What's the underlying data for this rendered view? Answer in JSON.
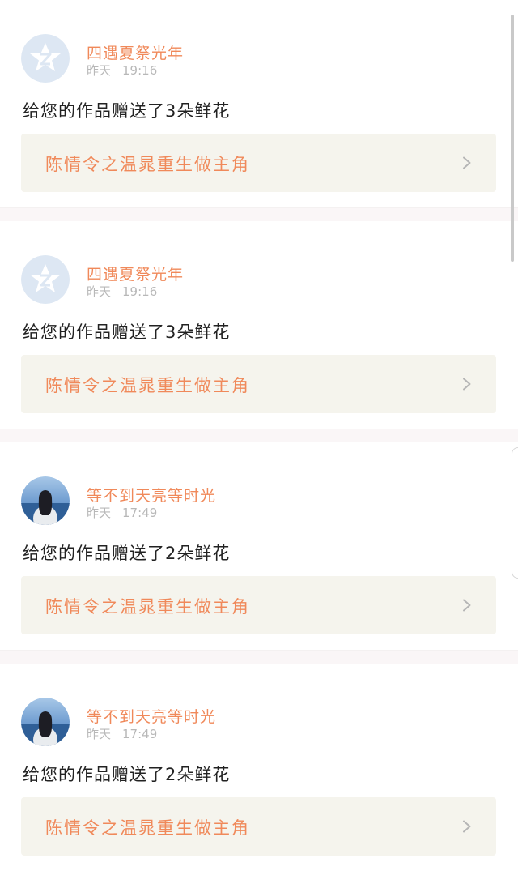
{
  "feed": {
    "items": [
      {
        "name": "四遇夏祭光年",
        "day": "昨天",
        "time": "19:16",
        "message": "给您的作品赠送了3朵鲜花",
        "work_title": "陈情令之温晁重生做主角",
        "avatar": "default-avatar"
      },
      {
        "name": "四遇夏祭光年",
        "day": "昨天",
        "time": "19:16",
        "message": "给您的作品赠送了3朵鲜花",
        "work_title": "陈情令之温晁重生做主角",
        "avatar": "default-avatar"
      },
      {
        "name": "等不到天亮等时光",
        "day": "昨天",
        "time": "17:49",
        "message": "给您的作品赠送了2朵鲜花",
        "work_title": "陈情令之温晁重生做主角",
        "avatar": "photo-avatar"
      },
      {
        "name": "等不到天亮等时光",
        "day": "昨天",
        "time": "17:49",
        "message": "给您的作品赠送了2朵鲜花",
        "work_title": "陈情令之温晁重生做主角",
        "avatar": "photo-avatar"
      }
    ]
  },
  "colors": {
    "accent": "#f0895a",
    "tab_indicator": "#e86aa0",
    "link_background": "#f5f4ed",
    "section_gap": "#faf6f7"
  }
}
